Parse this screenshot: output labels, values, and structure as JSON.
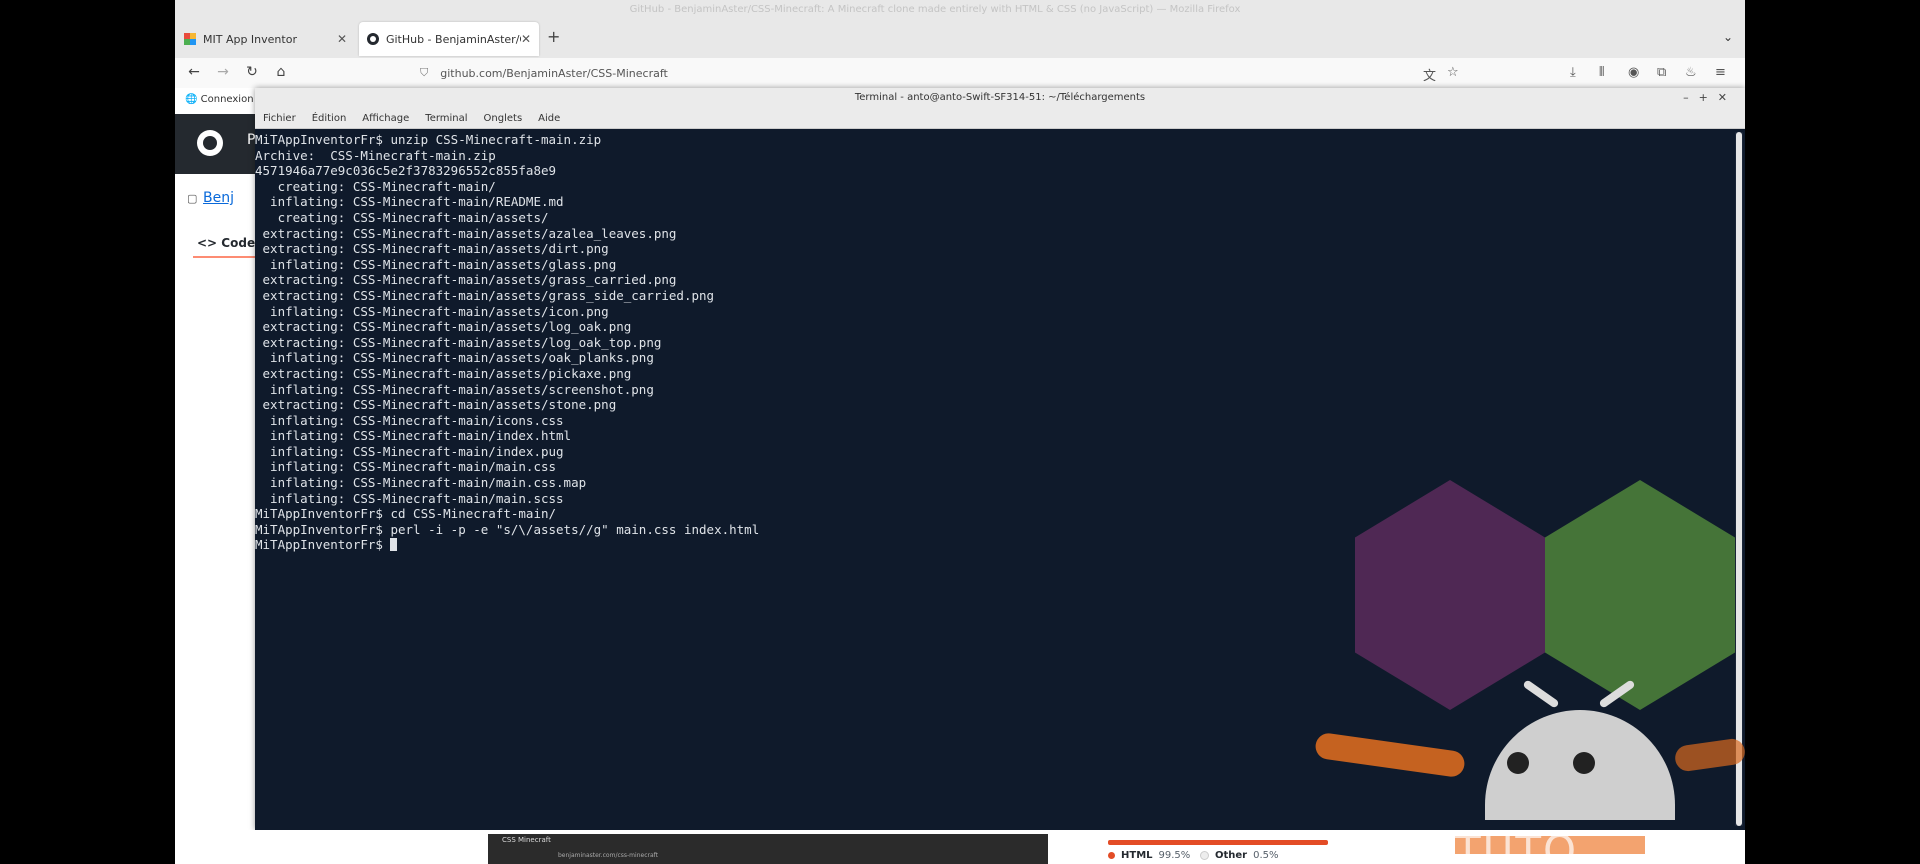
{
  "browser": {
    "window_title": "GitHub - BenjaminAster/CSS-Minecraft: A Minecraft clone made entirely with HTML & CSS (no JavaScript) — Mozilla Firefox",
    "tabs": [
      {
        "label": "MIT App Inventor",
        "active": false
      },
      {
        "label": "GitHub - BenjaminAster/CSS-Minecraft",
        "active": true
      }
    ],
    "url": "github.com/BenjaminAster/CSS-Minecraft"
  },
  "github_page": {
    "connexion_label": "Connexion à",
    "header_letter": "P",
    "repo_label": "Benj",
    "code_tab": "Code",
    "languages": [
      {
        "name": "HTML",
        "percent": "99.5%",
        "color": "#e34c26"
      },
      {
        "name": "Other",
        "percent": "0.5%",
        "color": "#ededed"
      }
    ],
    "mini_browser": {
      "tab": "CSS Minecraft",
      "url": "benjaminaster.com/css-minecraft"
    }
  },
  "terminal": {
    "title": "Terminal - anto@anto-Swift-SF314-51: ~/Téléchargements",
    "menu": [
      "Fichier",
      "Édition",
      "Affichage",
      "Terminal",
      "Onglets",
      "Aide"
    ],
    "lines": [
      "MiTAppInventorFr$ unzip CSS-Minecraft-main.zip",
      "Archive:  CSS-Minecraft-main.zip",
      "4571946a77e9c036c5e2f3783296552c855fa8e9",
      "   creating: CSS-Minecraft-main/",
      "  inflating: CSS-Minecraft-main/README.md",
      "   creating: CSS-Minecraft-main/assets/",
      " extracting: CSS-Minecraft-main/assets/azalea_leaves.png",
      " extracting: CSS-Minecraft-main/assets/dirt.png",
      "  inflating: CSS-Minecraft-main/assets/glass.png",
      " extracting: CSS-Minecraft-main/assets/grass_carried.png",
      " extracting: CSS-Minecraft-main/assets/grass_side_carried.png",
      "  inflating: CSS-Minecraft-main/assets/icon.png",
      " extracting: CSS-Minecraft-main/assets/log_oak.png",
      " extracting: CSS-Minecraft-main/assets/log_oak_top.png",
      "  inflating: CSS-Minecraft-main/assets/oak_planks.png",
      " extracting: CSS-Minecraft-main/assets/pickaxe.png",
      "  inflating: CSS-Minecraft-main/assets/screenshot.png",
      " extracting: CSS-Minecraft-main/assets/stone.png",
      "  inflating: CSS-Minecraft-main/icons.css",
      "  inflating: CSS-Minecraft-main/index.html",
      "  inflating: CSS-Minecraft-main/index.pug",
      "  inflating: CSS-Minecraft-main/main.css",
      "  inflating: CSS-Minecraft-main/main.css.map",
      "  inflating: CSS-Minecraft-main/main.scss",
      "MiTAppInventorFr$ cd CSS-Minecraft-main/",
      "MiTAppInventorFr$ perl -i -p -e \"s/\\/assets//g\" main.css index.html"
    ],
    "prompt": "MiTAppInventorFr$ "
  },
  "watermark": {
    "text": "TUTO"
  },
  "colors": {
    "terminal_bg": "#0f1a2b",
    "terminal_fg": "#dfe3e8",
    "github_header": "#24292f"
  }
}
